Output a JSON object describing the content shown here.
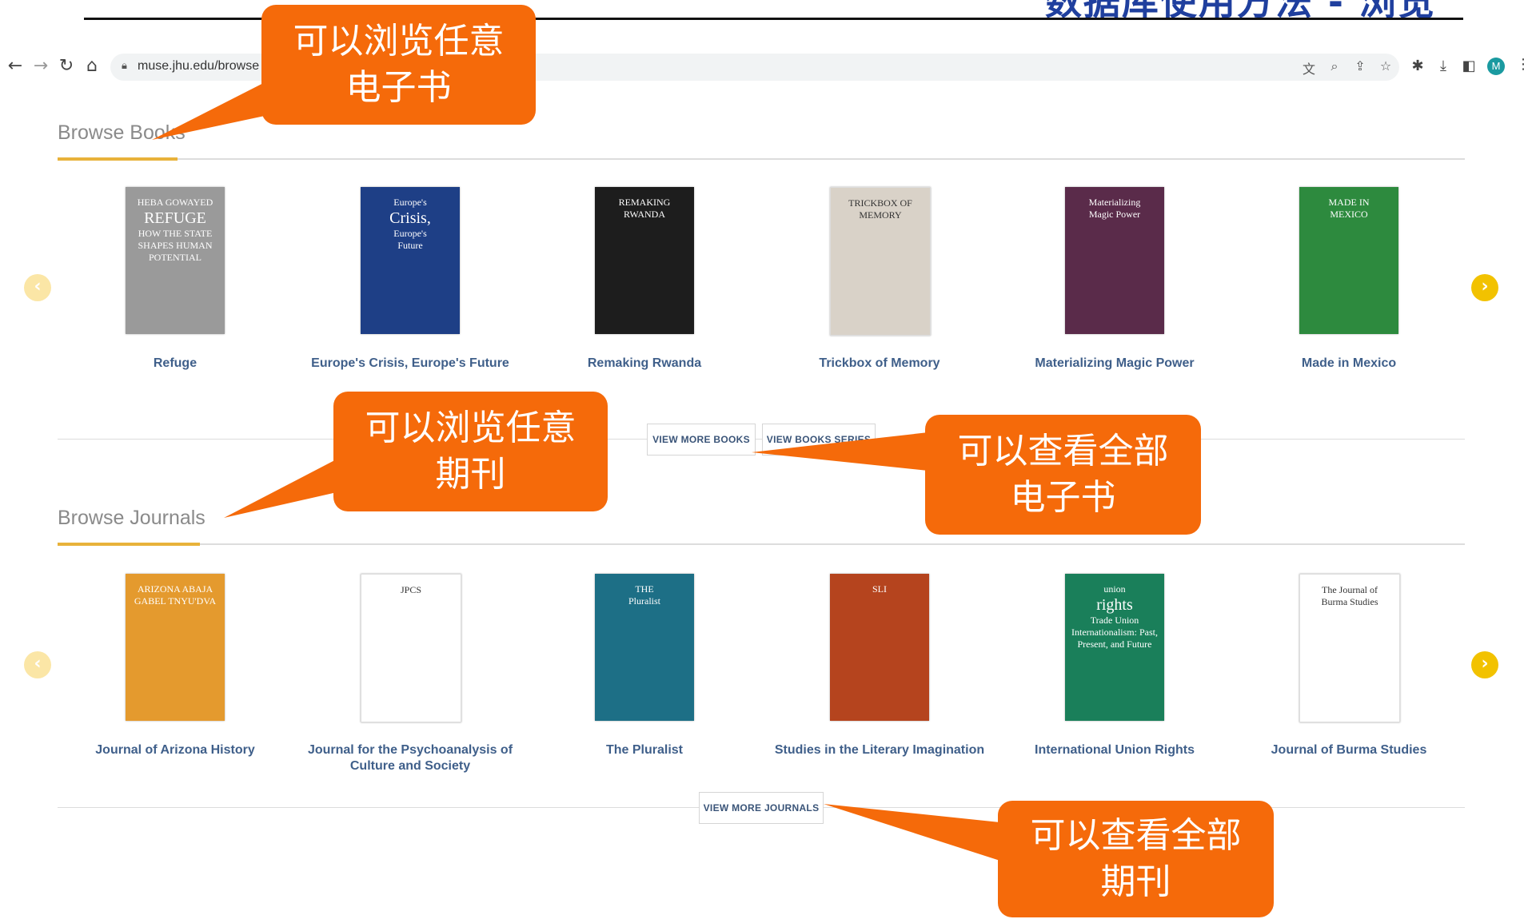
{
  "slide": {
    "title_partial": "数据库使用方法 - 浏览"
  },
  "browser": {
    "url": "muse.jhu.edu/browse",
    "avatar_letter": "M"
  },
  "books": {
    "heading": "Browse Books",
    "items": [
      {
        "title": "Refuge",
        "cover_lines": [
          "HEBA GOWAYED",
          "REFUGE",
          "HOW THE STATE SHAPES HUMAN POTENTIAL"
        ],
        "color": "#9a9a9a"
      },
      {
        "title": "Europe's Crisis, Europe's Future",
        "cover_lines": [
          "Europe's",
          "Crisis,",
          "Europe's",
          "Future"
        ],
        "color": "#1e3f86"
      },
      {
        "title": "Remaking Rwanda",
        "cover_lines": [
          "REMAKING RWANDA"
        ],
        "color": "#1d1d1d"
      },
      {
        "title": "Trickbox of Memory",
        "cover_lines": [
          "TRICKBOX OF MEMORY"
        ],
        "color": "#d9d2c8"
      },
      {
        "title": "Materializing Magic Power",
        "cover_lines": [
          "Materializing",
          "Magic Power"
        ],
        "color": "#5a2b4a"
      },
      {
        "title": "Made in Mexico",
        "cover_lines": [
          "MADE IN",
          "MEXICO"
        ],
        "color": "#2d8a3e"
      }
    ],
    "view_more": "VIEW MORE BOOKS",
    "view_series": "VIEW BOOKS SERIES"
  },
  "journals": {
    "heading": "Browse Journals",
    "items": [
      {
        "title": "Journal of Arizona History",
        "cover_lines": [
          "ARIZONA ABAJA",
          "GABEL TNYU'DVA"
        ],
        "color": "#e49a2e"
      },
      {
        "title": "Journal for the Psychoanalysis of Culture and Society",
        "cover_lines": [
          "JPCS"
        ],
        "color": "#ffffff"
      },
      {
        "title": "The Pluralist",
        "cover_lines": [
          "THE",
          "Pluralist"
        ],
        "color": "#1d6f86"
      },
      {
        "title": "Studies in the Literary Imagination",
        "cover_lines": [
          "SLI"
        ],
        "color": "#b5441e"
      },
      {
        "title": "International Union Rights",
        "cover_lines": [
          "union",
          "rights",
          "Trade Union Internationalism: Past, Present, and Future"
        ],
        "color": "#1a7f5a"
      },
      {
        "title": "Journal of Burma Studies",
        "cover_lines": [
          "The Journal of",
          "Burma Studies"
        ],
        "color": "#ffffff"
      }
    ],
    "view_more": "VIEW MORE JOURNALS"
  },
  "callouts": {
    "browse_books": [
      "可以浏览任意",
      "电子书"
    ],
    "browse_journals": [
      "可以浏览任意",
      "期刊"
    ],
    "view_all_books": [
      "可以查看全部",
      "电子书"
    ],
    "view_all_journals": [
      "可以查看全部",
      "期刊"
    ]
  },
  "colors": {
    "callout": "#f56a0a",
    "accent": "#e8b23a",
    "arrow": "#f2c200",
    "caption": "#3f5f8a"
  },
  "icons": [
    "back-icon",
    "forward-icon",
    "reload-icon",
    "home-icon",
    "lock-icon",
    "translate-icon",
    "zoom-icon",
    "share-icon",
    "star-icon",
    "extensions-icon",
    "download-icon",
    "sidepanel-icon",
    "menu-icon"
  ]
}
